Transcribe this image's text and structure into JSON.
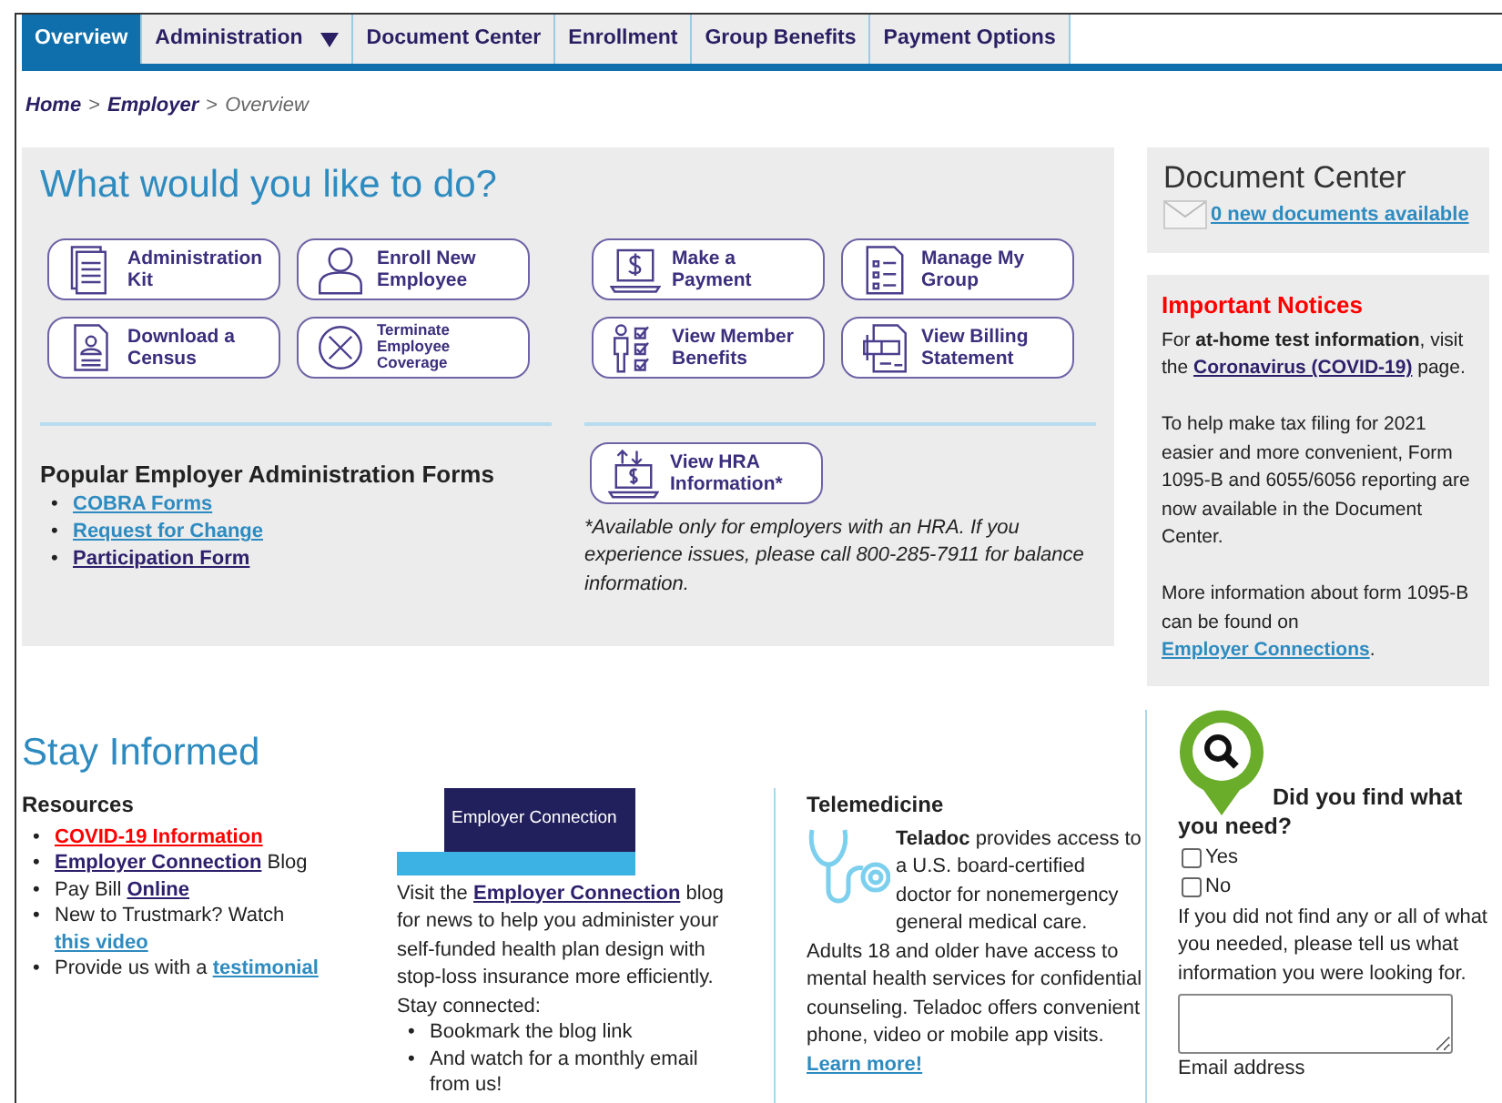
{
  "nav": {
    "tabs": [
      {
        "label": "Overview",
        "selected": true,
        "menu": false
      },
      {
        "label": "Administration",
        "selected": false,
        "menu": true
      },
      {
        "label": "Document Center",
        "selected": false,
        "menu": false
      },
      {
        "label": "Enrollment",
        "selected": false,
        "menu": false
      },
      {
        "label": "Group Benefits",
        "selected": false,
        "menu": false
      },
      {
        "label": "Payment Options",
        "selected": false,
        "menu": false
      }
    ]
  },
  "breadcrumb": {
    "separator": ">",
    "items": [
      {
        "label": "Home",
        "kind": "link"
      },
      {
        "label": "Employer",
        "kind": "link"
      },
      {
        "label": "Overview",
        "kind": "current"
      }
    ]
  },
  "actions": {
    "title": "What would you like to do?",
    "groups": [
      [
        {
          "label": "Administration Kit",
          "kind": "document"
        },
        {
          "label": "Enroll New Employee",
          "kind": "person"
        },
        {
          "label": "Download a Census",
          "kind": "census"
        },
        {
          "label": "Terminate Employee Coverage",
          "kind": "x-circle"
        }
      ],
      [
        {
          "label": "Make a Payment",
          "kind": "laptop-dollar"
        },
        {
          "label": "Manage My Group",
          "kind": "checklist"
        },
        {
          "label": "View Member Benefits",
          "kind": "person-checklist"
        },
        {
          "label": "View Billing Statement",
          "kind": "billing"
        }
      ]
    ]
  },
  "forms": {
    "title": "Popular Employer Administration Forms",
    "marker": "•",
    "links": [
      {
        "label": "COBRA Forms",
        "visited": false
      },
      {
        "label": "Request for Change",
        "visited": false
      },
      {
        "label": "Participation Form",
        "visited": true
      }
    ]
  },
  "hra": {
    "button": {
      "label": "View HRA Information*",
      "kind": "laptop-transfer"
    },
    "note": "*Available only for employers with an HRA. If you experience issues, please call 800-285-7911 for balance information."
  },
  "document_center": {
    "title": "Document Center",
    "link": "0 new documents available"
  },
  "notices": {
    "title": "Important Notices",
    "paragraphs": [
      [
        {
          "kind": "text",
          "text": "For **at-home test information**, visit the "
        },
        {
          "kind": "link",
          "text": "Coronavirus (COVID-19)",
          "visited": true
        },
        {
          "kind": "text",
          "text": " page."
        }
      ],
      [
        {
          "kind": "text",
          "text": "To help make tax filing for 2021 easier and more convenient, Form 1095-B and 6055/6056 reporting are now available in the Document Center."
        }
      ],
      [
        {
          "kind": "text",
          "text": "More information about  form 1095-B can be found on "
        },
        {
          "kind": "link",
          "text": "Employer Connections",
          "visited": false
        },
        {
          "kind": "text",
          "text": "."
        }
      ]
    ]
  },
  "stay_informed": {
    "title": "Stay Informed",
    "resources": {
      "title": "Resources",
      "marker": "•",
      "items": [
        [
          {
            "kind": "alert-link",
            "text": "COVID-19 Information",
            "visited": false
          }
        ],
        [
          {
            "kind": "link",
            "text": "Employer Connection",
            "visited": true
          },
          {
            "kind": "text",
            "text": " Blog"
          }
        ],
        [
          {
            "kind": "text",
            "text": "Pay Bill "
          },
          {
            "kind": "link",
            "text": "Online",
            "visited": true
          }
        ],
        [
          {
            "kind": "text",
            "text": "New to Trustmark? Watch "
          },
          {
            "kind": "link",
            "text": "this video",
            "visited": false
          }
        ],
        [
          {
            "kind": "text",
            "text": "Provide us with a "
          },
          {
            "kind": "link",
            "text": "testimonial",
            "visited": false
          }
        ]
      ]
    },
    "blog": {
      "banner": "Employer Connection",
      "paragraph": [
        {
          "kind": "text",
          "text": "Visit the "
        },
        {
          "kind": "link",
          "text": "Employer Connection",
          "visited": true
        },
        {
          "kind": "text",
          "text": " blog for news to help you administer your self-funded health plan design with stop-loss insurance more efficiently."
        }
      ],
      "stay_connected": "Stay connected:",
      "marker": "•",
      "bullets": [
        "Bookmark the blog link",
        "And watch for a monthly email from us!"
      ]
    },
    "telemedicine": {
      "title": "Telemedicine",
      "intro": "**Teladoc** provides access to a U.S. board-certified doctor for nonemergency general medical care.",
      "paragraph": [
        {
          "kind": "text",
          "text": "Adults 18 and older have access to mental health services for confidential counseling. Teladoc offers convenient phone, video or mobile app visits. "
        },
        {
          "kind": "link",
          "text": "Learn more!",
          "visited": false
        }
      ]
    }
  },
  "feedback": {
    "question": "Did you find what you need?",
    "options": [
      {
        "label": "Yes",
        "checked": false
      },
      {
        "label": "No",
        "checked": false
      }
    ],
    "prompt": "If you did not find any or all of what you needed, please tell us what information you were looking for.",
    "email_label": "Email address"
  }
}
